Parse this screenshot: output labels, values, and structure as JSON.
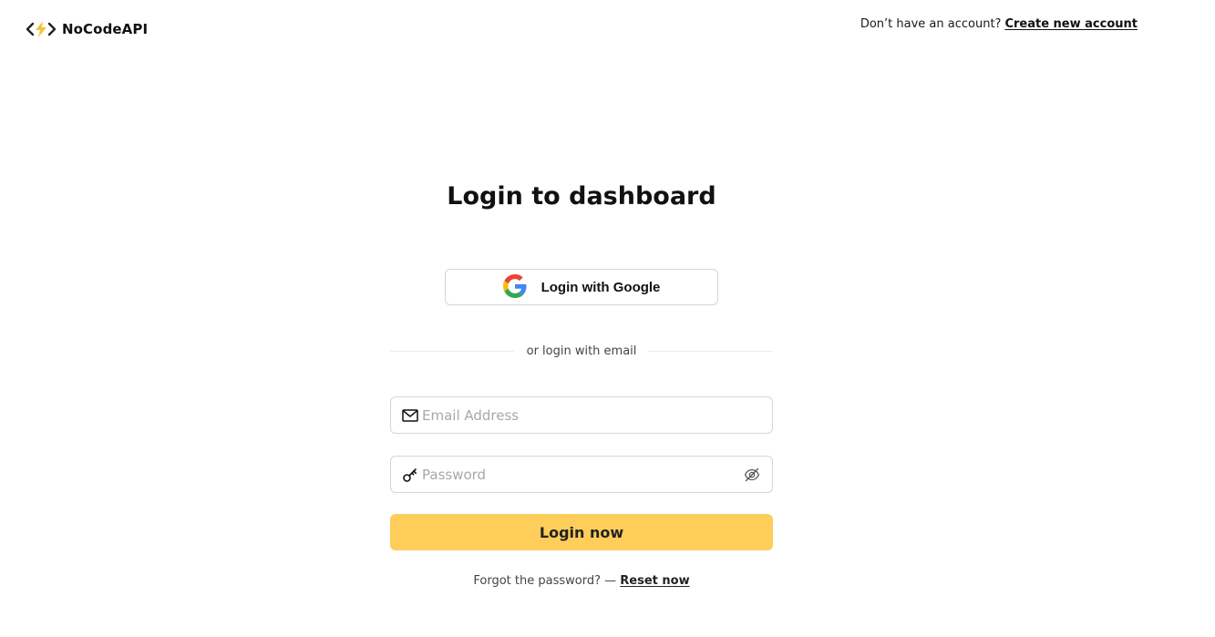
{
  "header": {
    "brand": "NoCodeAPI",
    "signup_prompt": "Don’t have an account?",
    "signup_link": "Create new account"
  },
  "main": {
    "title": "Login to dashboard",
    "google_button": "Login with Google",
    "divider_text": "or login with email",
    "email": {
      "placeholder": "Email Address",
      "value": ""
    },
    "password": {
      "placeholder": "Password",
      "value": ""
    },
    "login_button": "Login now",
    "forgot_text": "Forgot the password? —",
    "reset_link": "Reset now"
  },
  "icons": {
    "brand": "code-bolt-icon",
    "google": "google-icon",
    "email": "mail-icon",
    "password": "key-icon",
    "toggle": "eye-off-icon"
  },
  "colors": {
    "accent": "#fecd5a",
    "bolt": "#f5c43a",
    "text": "#111111",
    "border": "#d6d6d6"
  }
}
